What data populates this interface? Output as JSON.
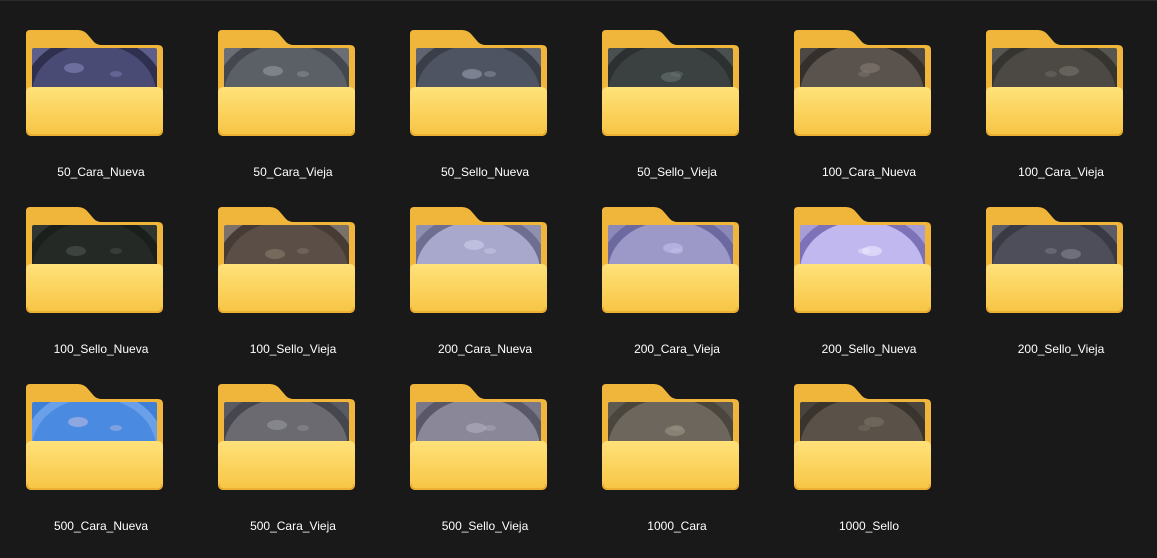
{
  "folders": [
    {
      "name": "50_Cara_Nueva",
      "thumb": {
        "bg": "#5d5f8a",
        "coin": "#4a4b74",
        "rim": "#2f3050",
        "hi": "#8a8cc0"
      }
    },
    {
      "name": "50_Cara_Vieja",
      "thumb": {
        "bg": "#6b6f75",
        "coin": "#5b5f66",
        "rim": "#44484e",
        "hi": "#9aa0a8"
      }
    },
    {
      "name": "50_Sello_Nueva",
      "thumb": {
        "bg": "#5f6470",
        "coin": "#4f5462",
        "rim": "#3a3e48",
        "hi": "#a0a6b8"
      }
    },
    {
      "name": "50_Sello_Vieja",
      "thumb": {
        "bg": "#4a5050",
        "coin": "#3b4141",
        "rim": "#2c3030",
        "hi": "#6e7676"
      }
    },
    {
      "name": "100_Cara_Nueva",
      "thumb": {
        "bg": "#4e4844",
        "coin": "#5a524c",
        "rim": "#352f2b",
        "hi": "#8a8078"
      }
    },
    {
      "name": "100_Cara_Vieja",
      "thumb": {
        "bg": "#585650",
        "coin": "#4c4944",
        "rim": "#36342f",
        "hi": "#7a7670"
      }
    },
    {
      "name": "100_Sello_Nueva",
      "thumb": {
        "bg": "#2f3530",
        "coin": "#242926",
        "rim": "#1b1f1c",
        "hi": "#525a54"
      }
    },
    {
      "name": "100_Sello_Vieja",
      "thumb": {
        "bg": "#7a7268",
        "coin": "#5a4e46",
        "rim": "#463c35",
        "hi": "#8c8070"
      }
    },
    {
      "name": "200_Cara_Nueva",
      "thumb": {
        "bg": "#8f8fb0",
        "coin": "#a8a8cc",
        "rim": "#6e6e90",
        "hi": "#d0d0ee"
      }
    },
    {
      "name": "200_Cara_Vieja",
      "thumb": {
        "bg": "#8c88b8",
        "coin": "#9c98c8",
        "rim": "#6c68a0",
        "hi": "#c8c4ee"
      }
    },
    {
      "name": "200_Sello_Nueva",
      "thumb": {
        "bg": "#a79ed8",
        "coin": "#c2b8f0",
        "rim": "#7d72b8",
        "hi": "#f0ecff"
      }
    },
    {
      "name": "200_Sello_Vieja",
      "thumb": {
        "bg": "#5c5c66",
        "coin": "#4e4e5a",
        "rim": "#3a3a44",
        "hi": "#8a8a98"
      }
    },
    {
      "name": "500_Cara_Nueva",
      "thumb": {
        "bg": "#3f7fd6",
        "coin": "#4a8ae0",
        "rim": "#6aa0ea",
        "hi": "#c8c0e0"
      }
    },
    {
      "name": "500_Cara_Vieja",
      "thumb": {
        "bg": "#595a62",
        "coin": "#6a6a70",
        "rim": "#45464e",
        "hi": "#9a9aa4"
      }
    },
    {
      "name": "500_Sello_Vieja",
      "thumb": {
        "bg": "#7a7888",
        "coin": "#8a8898",
        "rim": "#5a5868",
        "hi": "#b4b2c4"
      }
    },
    {
      "name": "1000_Cara",
      "thumb": {
        "bg": "#5e5a52",
        "coin": "#6c665c",
        "rim": "#4a463e",
        "hi": "#a09888"
      }
    },
    {
      "name": "1000_Sello",
      "thumb": {
        "bg": "#4a443c",
        "coin": "#5a5248",
        "rim": "#3a342e",
        "hi": "#7e7468"
      }
    }
  ],
  "colors": {
    "background": "#191919",
    "label": "#ffffff",
    "folder_back": "#f0b53b",
    "folder_front_top": "#ffe27a",
    "folder_front_bottom": "#f7c443",
    "folder_edge": "#e8a92c"
  },
  "icons": {
    "folder": "folder-icon"
  }
}
